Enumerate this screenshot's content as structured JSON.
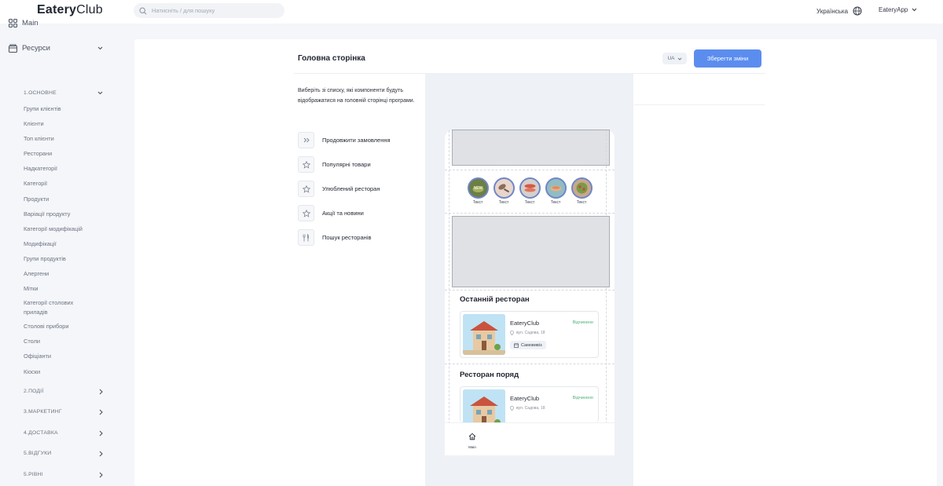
{
  "app": {
    "logo_bold": "Eatery",
    "logo_light": "Club",
    "search_placeholder": "Натисніть / для пошуку",
    "language": "Українська",
    "account": "EateryApp"
  },
  "sidebar": {
    "main": "Main",
    "resources": "Ресурси",
    "sections": [
      {
        "label": "1.ОСНОВНЕ",
        "expanded": true
      },
      {
        "label": "2.ПОДІЇ",
        "expanded": false
      },
      {
        "label": "3.МАРКЕТИНГ",
        "expanded": false
      },
      {
        "label": "4.ДОСТАВКА",
        "expanded": false
      },
      {
        "label": "5.ВІДГУКИ",
        "expanded": false
      },
      {
        "label": "5.РІВНІ",
        "expanded": false
      }
    ],
    "items": [
      "Групи клієнтів",
      "Клієнти",
      "Топ клієнти",
      "Ресторани",
      "Надкатегорії",
      "Категорії",
      "Продукти",
      "Варіації продукту",
      "Категорії модифікацій",
      "Модифікації",
      "Групи продуктів",
      "Алергени",
      "Мітки",
      "Категорії столових приладів",
      "Столові прибори",
      "Столи",
      "Офіціанти",
      "Кіоски"
    ]
  },
  "page": {
    "title": "Головна сторінка",
    "lang_select": "UA",
    "save_button": "Зберегти зміни",
    "description": "Виберіть зі списку, які компоненти будуть відображатися на головній сторінці програми.",
    "components": [
      {
        "label": "Продовжити замовлення",
        "icon": "double-chevron-icon"
      },
      {
        "label": "Популярні товари",
        "icon": "star-icon"
      },
      {
        "label": "Улюблений ресторан",
        "icon": "star-icon"
      },
      {
        "label": "Акції та новини",
        "icon": "star-icon"
      },
      {
        "label": "Пошук ресторанів",
        "icon": "cutlery-icon"
      }
    ]
  },
  "preview": {
    "categories": [
      {
        "label": "Текст",
        "badge": "NEW",
        "color": "#5b8f3a"
      },
      {
        "label": "Текст",
        "color": "#c7a58e"
      },
      {
        "label": "Текст",
        "color": "#d5584a"
      },
      {
        "label": "Текст",
        "color": "#e4b48a"
      },
      {
        "label": "Текст",
        "color": "#6fa04d"
      }
    ],
    "last_restaurant_title": "Останній ресторан",
    "nearby_title": "Ресторан поряд",
    "restaurant": {
      "name": "EateryClub",
      "status": "Відчинено",
      "address": "вул. Садова, 18",
      "tag": "Самовивіз"
    },
    "tab_main": "Main"
  }
}
